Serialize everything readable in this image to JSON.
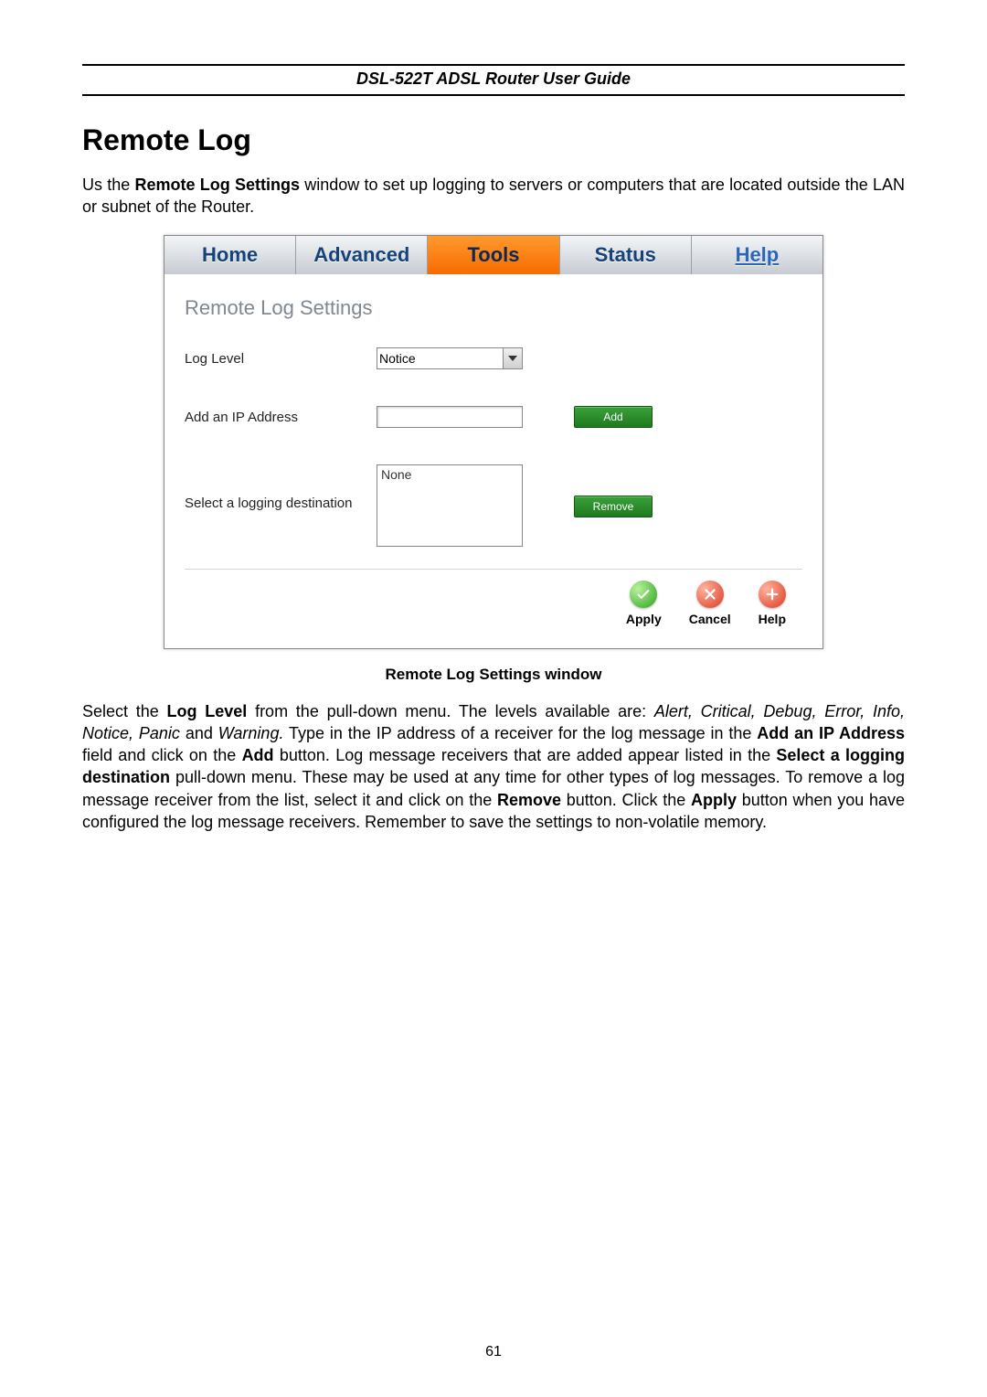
{
  "doc": {
    "header_title": "DSL-522T ADSL Router User Guide",
    "page_number": "61",
    "section_title": "Remote Log",
    "intro_pre": "Us the ",
    "intro_bold": "Remote Log Settings",
    "intro_post": " window to set up logging to servers or computers that are located outside the LAN or subnet of the Router.",
    "caption": "Remote Log Settings window",
    "body": {
      "t1": "Select the ",
      "b1": "Log Level",
      "t2": " from the pull-down menu. The levels available are: ",
      "i1": "Alert, Critical, Debug, Error, Info, Notice, Panic",
      "t3": " and ",
      "i2": "Warning.",
      "t4": " Type in the IP address of a receiver for the log message in the ",
      "b2": "Add an IP Address",
      "t5": " field and click on the ",
      "b3": "Add",
      "t6": " button. Log message receivers that are added appear listed in the ",
      "b4": "Select a logging destination",
      "t7": " pull-down menu. These may be used at any time for other types of log messages. To remove a log message receiver from the list, select it and click on the ",
      "b5": "Remove",
      "t8": " button. Click the ",
      "b6": "Apply",
      "t9": " button when you have configured the log message receivers. Remember to save the settings to non-volatile memory."
    }
  },
  "ui": {
    "tabs": {
      "home": "Home",
      "advanced": "Advanced",
      "tools": "Tools",
      "status": "Status",
      "help": "Help"
    },
    "panel_title": "Remote Log Settings",
    "labels": {
      "log_level": "Log Level",
      "add_ip": "Add an IP Address",
      "select_dest": "Select a logging destination"
    },
    "values": {
      "log_level_selected": "Notice",
      "ip_input": "",
      "dest_list_item": "None"
    },
    "buttons": {
      "add": "Add",
      "remove": "Remove"
    },
    "footer": {
      "apply": "Apply",
      "cancel": "Cancel",
      "help": "Help"
    }
  }
}
